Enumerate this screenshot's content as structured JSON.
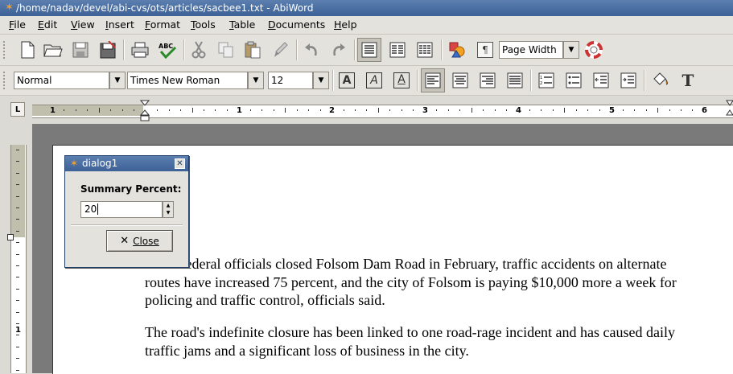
{
  "window": {
    "title": "/home/nadav/devel/abi-cvs/ots/articles/sacbee1.txt - AbiWord",
    "icon": "abiword-star-icon"
  },
  "menubar": {
    "items": [
      {
        "label": "File",
        "mnemonic": "F",
        "rest": "ile"
      },
      {
        "label": "Edit",
        "mnemonic": "E",
        "rest": "dit"
      },
      {
        "label": "View",
        "mnemonic": "V",
        "rest": "iew"
      },
      {
        "label": "Insert",
        "mnemonic": "I",
        "rest": "nsert"
      },
      {
        "label": "Format",
        "mnemonic": "F",
        "rest": "ormat"
      },
      {
        "label": "Tools",
        "mnemonic": "T",
        "rest": "ools"
      },
      {
        "label": "Table",
        "mnemonic": "T",
        "rest": "able"
      },
      {
        "label": "Documents",
        "mnemonic": "D",
        "rest": "ocuments"
      },
      {
        "label": "Help",
        "mnemonic": "H",
        "rest": "elp"
      }
    ]
  },
  "toolbar_standard": {
    "zoom_value": "Page Width"
  },
  "toolbar_format": {
    "style_value": "Normal",
    "font_value": "Times New Roman",
    "size_value": "12"
  },
  "ruler": {
    "horizontal_numbers": [
      "1",
      "1",
      "2",
      "3",
      "4",
      "5",
      "6"
    ],
    "vertical_numbers": [
      "1"
    ],
    "tab_type_glyph": "L"
  },
  "document": {
    "paragraph1_lines": [
      "Since federal officials closed Folsom Dam Road in February, traffic accidents on alternate",
      "routes have increased 75 percent, and the city of Folsom is paying $10,000 more a week for",
      "policing and traffic control, officials said."
    ],
    "paragraph2_lines": [
      "The road's indefinite closure has been linked to one road-rage incident and has caused daily",
      "traffic jams and a significant loss of business in the city."
    ]
  },
  "dialog": {
    "title": "dialog1",
    "label": "Summary Percent:",
    "value": "20",
    "close_button": "Close"
  },
  "colors": {
    "titlebar": "#4a6fa5",
    "workspace": "#7a7a7a",
    "ruler_margin": "#c0bfae",
    "pressed_button": "#c6c3bb"
  }
}
